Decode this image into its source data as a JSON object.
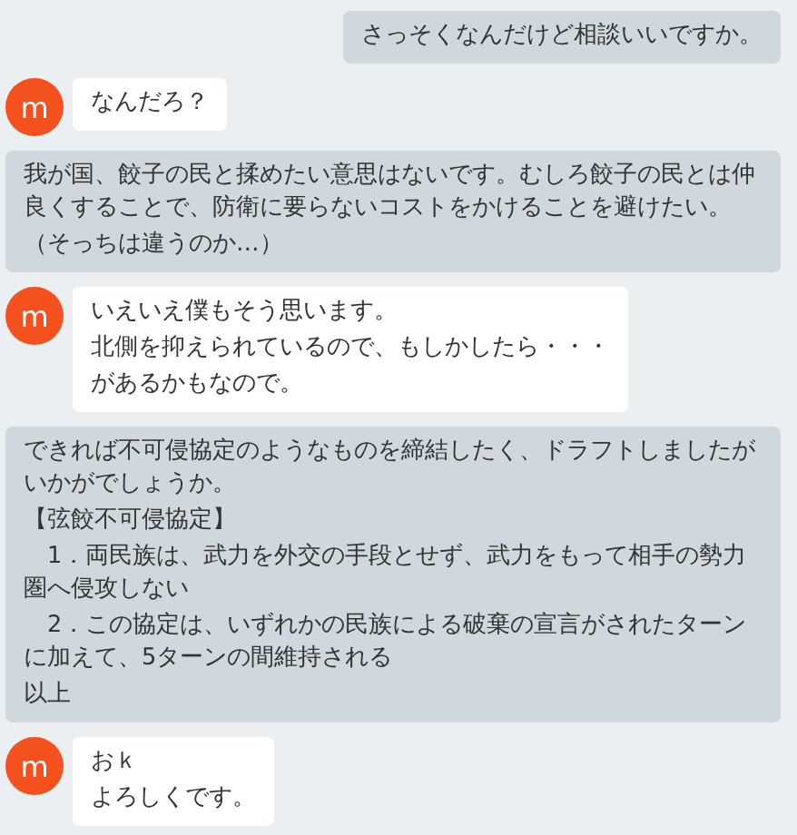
{
  "messages": [
    {
      "kind": "sent",
      "paragraphs": [
        "さっそくなんだけど相談いいですか。"
      ]
    },
    {
      "kind": "received",
      "avatar": "m",
      "paragraphs": [
        "なんだろ？"
      ]
    },
    {
      "kind": "sent",
      "paragraphs": [
        "我が国、餃子の民と揉めたい意思はないです。むしろ餃子の民とは仲良くすることで、防衛に要らないコストをかけることを避けたい。",
        "（そっちは違うのか…）"
      ]
    },
    {
      "kind": "received",
      "avatar": "m",
      "paragraphs": [
        "いえいえ僕もそう思います。",
        "北側を抑えられているので、もしかしたら・・・",
        "があるかもなので。"
      ]
    },
    {
      "kind": "sent",
      "paragraphs": [
        "できれば不可侵協定のようなものを締結したく、ドラフトしましたがいかがでしょうか。",
        "【弦餃不可侵協定】",
        "　1．両民族は、武力を外交の手段とせず、武力をもって相手の勢力圏へ侵攻しない",
        "　2．この協定は、いずれかの民族による破棄の宣言がされたターンに加えて、5ターンの間維持される",
        "以上"
      ]
    },
    {
      "kind": "received",
      "avatar": "m",
      "paragraphs": [
        "おｋ",
        "よろしくです。"
      ]
    }
  ]
}
